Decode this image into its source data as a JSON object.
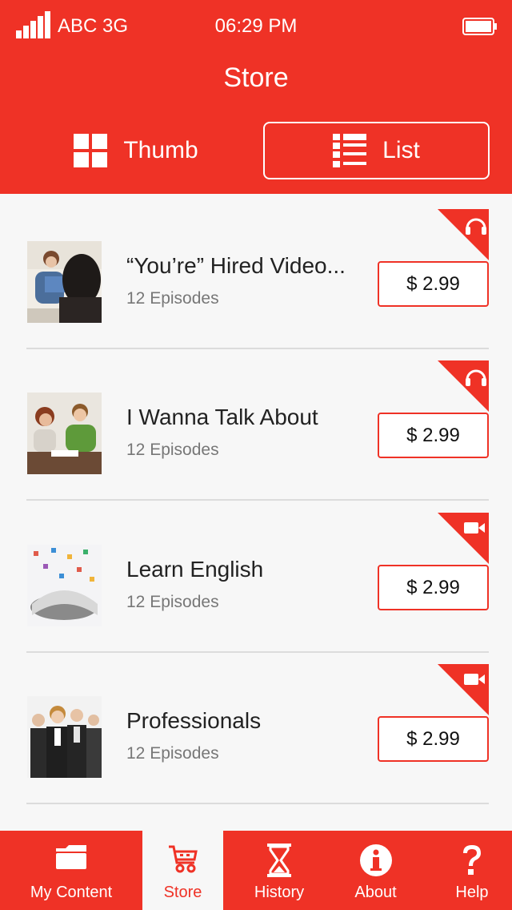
{
  "status": {
    "carrier": "ABC 3G",
    "time": "06:29 PM"
  },
  "header": {
    "title": "Store"
  },
  "view_toggle": {
    "thumb_label": "Thumb",
    "list_label": "List",
    "selected": "List"
  },
  "items": [
    {
      "title": "“You’re” Hired Video...",
      "subtitle": "12 Episodes",
      "price": "$ 2.99",
      "media": "headphones-icon"
    },
    {
      "title": "I Wanna Talk About",
      "subtitle": "12 Episodes",
      "price": "$ 2.99",
      "media": "headphones-icon"
    },
    {
      "title": "Learn English",
      "subtitle": "12 Episodes",
      "price": "$ 2.99",
      "media": "video-camera-icon"
    },
    {
      "title": "Professionals",
      "subtitle": "12 Episodes",
      "price": "$ 2.99",
      "media": "video-camera-icon"
    }
  ],
  "tabs": [
    {
      "label": "My Content",
      "icon": "folder-icon"
    },
    {
      "label": "Store",
      "icon": "cart-icon",
      "active": true
    },
    {
      "label": "History",
      "icon": "hourglass-icon"
    },
    {
      "label": "About",
      "icon": "info-icon"
    },
    {
      "label": "Help",
      "icon": "question-icon"
    }
  ],
  "colors": {
    "accent": "#ef3226",
    "background": "#f7f7f7",
    "divider": "#dcdcdc"
  }
}
